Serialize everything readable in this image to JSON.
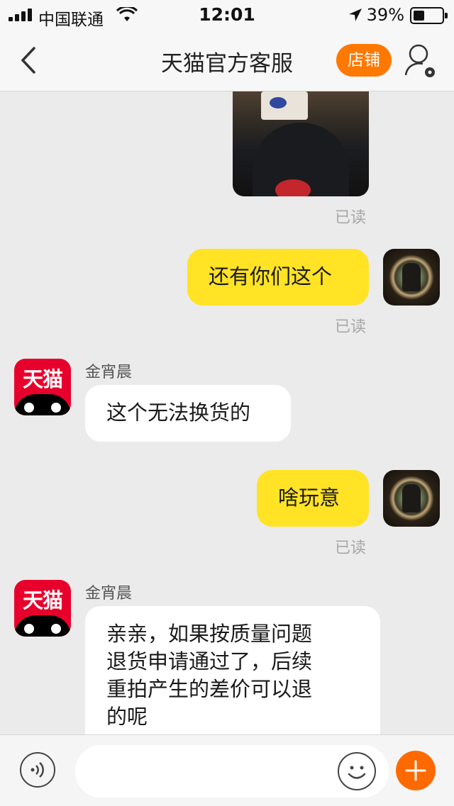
{
  "status_bar": {
    "carrier": "中国联通",
    "time": "12:01",
    "battery": "39%"
  },
  "header": {
    "back_icon": "chevron-left-icon",
    "title": "天猫官方客服",
    "shop_label": "店铺",
    "user_settings_icon": "user-settings-icon"
  },
  "messages": [
    {
      "from": "me",
      "type": "image",
      "status": "已读"
    },
    {
      "from": "me",
      "type": "text",
      "text": "还有你们这个",
      "status": "已读"
    },
    {
      "from": "agent",
      "sender": "金宵晨",
      "avatar_text": "天猫",
      "type": "text",
      "text": "这个无法换货的"
    },
    {
      "from": "me",
      "type": "text",
      "text": "啥玩意",
      "status": "已读"
    },
    {
      "from": "agent",
      "sender": "金宵晨",
      "avatar_text": "天猫",
      "type": "text",
      "lines": [
        "亲亲，如果按质量问题",
        "退货申请通过了，后续",
        "重拍产生的差价可以退",
        "的呢"
      ]
    }
  ],
  "input_bar": {
    "voice_icon": "voice-icon",
    "placeholder": "",
    "emoji_icon": "emoji-icon",
    "plus_icon": "plus-icon"
  },
  "colors": {
    "accent": "#ff7800",
    "my_bubble": "#ffe324",
    "tmall_red": "#e8002d"
  }
}
